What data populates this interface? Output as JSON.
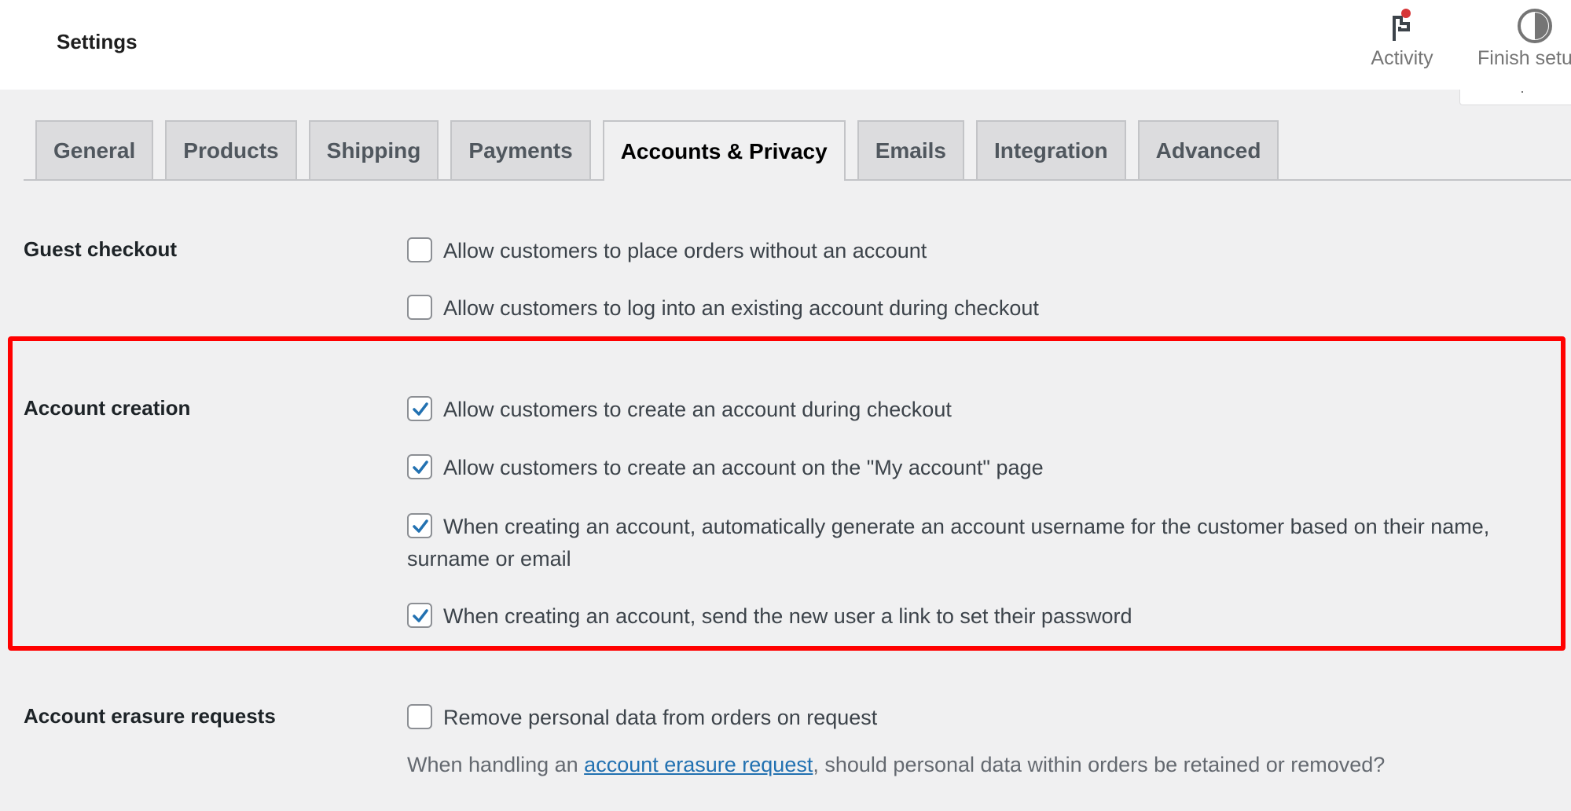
{
  "header": {
    "title": "Settings",
    "actions": [
      {
        "label": "Activity",
        "icon": "flag-icon",
        "has_notification": true
      },
      {
        "label": "Finish setup",
        "icon": "half-circle-progress-icon"
      }
    ]
  },
  "tabs": [
    {
      "label": "General",
      "active": false
    },
    {
      "label": "Products",
      "active": false
    },
    {
      "label": "Shipping",
      "active": false
    },
    {
      "label": "Payments",
      "active": false
    },
    {
      "label": "Accounts & Privacy",
      "active": true
    },
    {
      "label": "Emails",
      "active": false
    },
    {
      "label": "Integration",
      "active": false
    },
    {
      "label": "Advanced",
      "active": false
    }
  ],
  "sections": {
    "guest_checkout": {
      "label": "Guest checkout",
      "options": [
        {
          "label": "Allow customers to place orders without an account",
          "checked": false
        },
        {
          "label": "Allow customers to log into an existing account during checkout",
          "checked": false
        }
      ]
    },
    "account_creation": {
      "label": "Account creation",
      "options": [
        {
          "label": "Allow customers to create an account during checkout",
          "checked": true
        },
        {
          "label": "Allow customers to create an account on the \"My account\" page",
          "checked": true
        },
        {
          "label": "When creating an account, automatically generate an account username for the customer based on their name, surname or email",
          "checked": true
        },
        {
          "label": "When creating an account, send the new user a link to set their password",
          "checked": true
        }
      ]
    },
    "account_erasure": {
      "label": "Account erasure requests",
      "options": [
        {
          "label": "Remove personal data from orders on request",
          "checked": false
        }
      ],
      "description_prefix": "When handling an ",
      "description_link": "account erasure request",
      "description_suffix": ", should personal data within orders be retained or removed?"
    }
  },
  "colors": {
    "highlight": "#ff0000",
    "link": "#2271b1",
    "check": "#2271b1",
    "notification_dot": "#d63638"
  }
}
